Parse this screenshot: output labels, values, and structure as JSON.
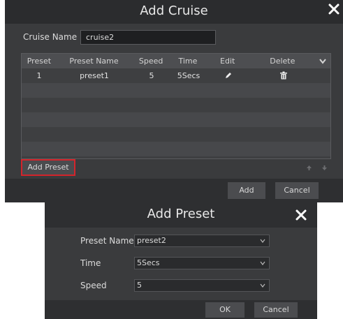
{
  "add_cruise": {
    "title": "Add Cruise",
    "cruise_name_label": "Cruise Name",
    "cruise_name_value": "cruise2",
    "table": {
      "columns": [
        "Preset",
        "Preset Name",
        "Speed",
        "Time",
        "Edit",
        "Delete"
      ],
      "rows": [
        {
          "preset": "1",
          "preset_name": "preset1",
          "speed": "5",
          "time": "5Secs",
          "edit_icon": "pencil-icon",
          "delete_icon": "trash-icon"
        }
      ]
    },
    "add_preset_label": "Add Preset",
    "add_label": "Add",
    "cancel_label": "Cancel",
    "highlight_color": "#d4242b"
  },
  "add_preset": {
    "title": "Add Preset",
    "fields": [
      {
        "label": "Preset Name",
        "value": "preset2"
      },
      {
        "label": "Time",
        "value": "5Secs"
      },
      {
        "label": "Speed",
        "value": "5"
      }
    ],
    "ok_label": "OK",
    "cancel_label": "Cancel"
  }
}
